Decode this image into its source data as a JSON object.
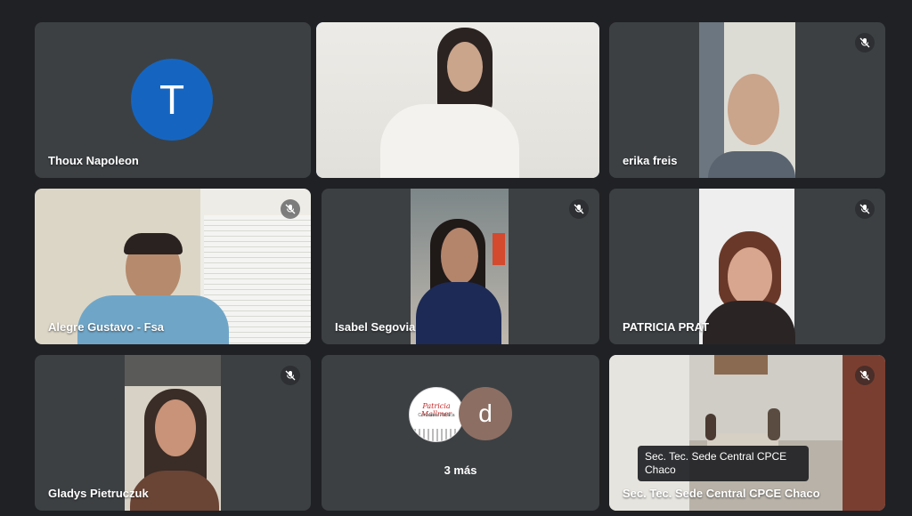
{
  "participants": [
    {
      "name": "Thoux Napoleon",
      "initial": "T",
      "avatar_color": "#1565c0",
      "muted": false
    },
    {
      "name": "",
      "muted": false,
      "speaking": true
    },
    {
      "name": "erika freis",
      "muted": true
    },
    {
      "name": "Alegre Gustavo - Fsa",
      "muted": true
    },
    {
      "name": "Isabel Segovia",
      "muted": true
    },
    {
      "name": "PATRICIA PRAT",
      "muted": true
    },
    {
      "name": "Gladys Pietruczuk",
      "muted": true
    },
    {
      "more_label": "3 más",
      "more_initial": "d",
      "more_avatar_text": "Patricia Mallmer",
      "more_avatar_sub": "Contadora Pública"
    },
    {
      "name": "Sec. Tec. Sede Central CPCE Chaco",
      "muted": true,
      "tooltip": "Sec. Tec. Sede Central CPCE Chaco"
    }
  ],
  "colors": {
    "background": "#202124",
    "tile": "#3c4043",
    "speaking_border": "#8ab4f8",
    "avatar_d": "#8d6e63"
  }
}
